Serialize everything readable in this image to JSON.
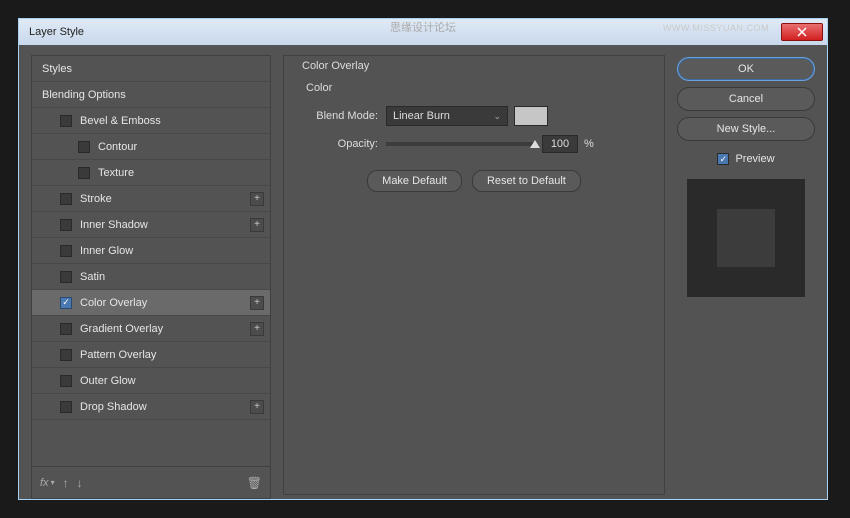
{
  "window": {
    "title": "Layer Style"
  },
  "watermark": {
    "center": "思缘设计论坛",
    "url": "WWW.MISSYUAN.COM"
  },
  "sidebar": {
    "header1": "Styles",
    "header2": "Blending Options",
    "items": [
      {
        "label": "Bevel & Emboss",
        "checked": false,
        "plus": false,
        "indent": 1
      },
      {
        "label": "Contour",
        "checked": false,
        "plus": false,
        "indent": 2
      },
      {
        "label": "Texture",
        "checked": false,
        "plus": false,
        "indent": 2
      },
      {
        "label": "Stroke",
        "checked": false,
        "plus": true,
        "indent": 1
      },
      {
        "label": "Inner Shadow",
        "checked": false,
        "plus": true,
        "indent": 1
      },
      {
        "label": "Inner Glow",
        "checked": false,
        "plus": false,
        "indent": 1
      },
      {
        "label": "Satin",
        "checked": false,
        "plus": false,
        "indent": 1
      },
      {
        "label": "Color Overlay",
        "checked": true,
        "plus": true,
        "indent": 1,
        "selected": true
      },
      {
        "label": "Gradient Overlay",
        "checked": false,
        "plus": true,
        "indent": 1
      },
      {
        "label": "Pattern Overlay",
        "checked": false,
        "plus": false,
        "indent": 1
      },
      {
        "label": "Outer Glow",
        "checked": false,
        "plus": false,
        "indent": 1
      },
      {
        "label": "Drop Shadow",
        "checked": false,
        "plus": true,
        "indent": 1
      }
    ],
    "footer_fx": "fx"
  },
  "panel": {
    "title": "Color Overlay",
    "group": "Color",
    "blend_label": "Blend Mode:",
    "blend_value": "Linear Burn",
    "opacity_label": "Opacity:",
    "opacity_value": "100",
    "opacity_unit": "%",
    "make_default": "Make Default",
    "reset_default": "Reset to Default"
  },
  "right": {
    "ok": "OK",
    "cancel": "Cancel",
    "newstyle": "New Style...",
    "preview": "Preview"
  }
}
